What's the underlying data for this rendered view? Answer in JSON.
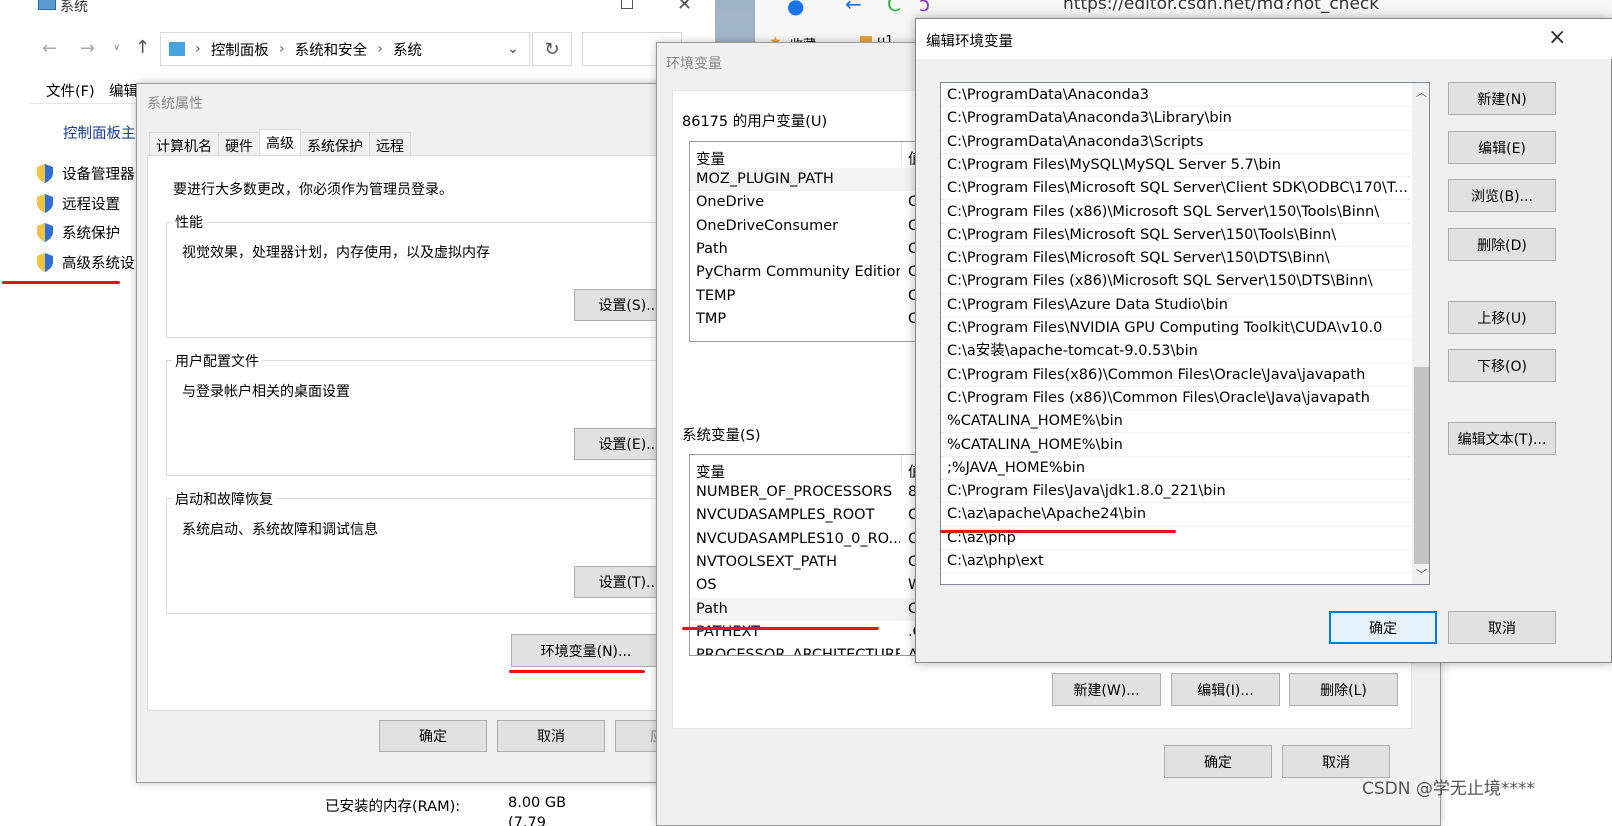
{
  "explorer": {
    "title": "系统",
    "breadcrumb": [
      "控制面板",
      "系统和安全",
      "系统"
    ],
    "menu": [
      "文件(F)",
      "编辑"
    ],
    "sidebar_home": "控制面板主",
    "sidebar_items": [
      "设备管理器",
      "远程设置",
      "系统保护",
      "高级系统设"
    ],
    "ram_label": "已安装的内存(RAM):",
    "ram_value": "8.00 GB",
    "ram_value2": "(7.79"
  },
  "browser": {
    "url": "https://editor.csdn.net/md?not_check",
    "bookmark": "收藏",
    "bookmark2": "u1"
  },
  "sysprops": {
    "title": "系统属性",
    "tabs": [
      "计算机名",
      "硬件",
      "高级",
      "系统保护",
      "远程"
    ],
    "admin_note": "要进行大多数更改，你必须作为管理员登录。",
    "groups": [
      {
        "label": "性能",
        "desc": "视觉效果，处理器计划，内存使用，以及虚拟内存",
        "button": "设置(S)..."
      },
      {
        "label": "用户配置文件",
        "desc": "与登录帐户相关的桌面设置",
        "button": "设置(E)..."
      },
      {
        "label": "启动和故障恢复",
        "desc": "系统启动、系统故障和调试信息",
        "button": "设置(T)..."
      }
    ],
    "env_button": "环境变量(N)...",
    "ok": "确定",
    "cancel": "取消",
    "apply": "应"
  },
  "envvars": {
    "title": "环境变量",
    "user_label": "86175 的用户变量(U)",
    "col_var": "变量",
    "col_val": "值",
    "user_vars": [
      {
        "name": "MOZ_PLUGIN_PATH",
        "val": ""
      },
      {
        "name": "OneDrive",
        "val": "C"
      },
      {
        "name": "OneDriveConsumer",
        "val": "C"
      },
      {
        "name": "Path",
        "val": "C"
      },
      {
        "name": "PyCharm Community Edition",
        "val": "C"
      },
      {
        "name": "TEMP",
        "val": "C"
      },
      {
        "name": "TMP",
        "val": "C"
      }
    ],
    "sys_label": "系统变量(S)",
    "sys_vars": [
      {
        "name": "NUMBER_OF_PROCESSORS",
        "val": "8"
      },
      {
        "name": "NVCUDASAMPLES_ROOT",
        "val": "C"
      },
      {
        "name": "NVCUDASAMPLES10_0_RO...",
        "val": "C"
      },
      {
        "name": "NVTOOLSEXT_PATH",
        "val": "C"
      },
      {
        "name": "OS",
        "val": "W"
      },
      {
        "name": "Path",
        "val": "C"
      },
      {
        "name": "PATHEXT",
        "val": ".C"
      },
      {
        "name": "PROCESSOR_ARCHITECTURE",
        "val": "A"
      }
    ],
    "new_btn": "新建(W)...",
    "edit_btn": "编辑(I)...",
    "delete_btn": "删除(L)",
    "ok": "确定",
    "cancel": "取消"
  },
  "editenv": {
    "title": "编辑环境变量",
    "close": "×",
    "paths": [
      "C:\\ProgramData\\Anaconda3",
      "C:\\ProgramData\\Anaconda3\\Library\\bin",
      "C:\\ProgramData\\Anaconda3\\Scripts",
      "C:\\Program Files\\MySQL\\MySQL Server 5.7\\bin",
      "C:\\Program Files\\Microsoft SQL Server\\Client SDK\\ODBC\\170\\T...",
      "C:\\Program Files (x86)\\Microsoft SQL Server\\150\\Tools\\Binn\\",
      "C:\\Program Files\\Microsoft SQL Server\\150\\Tools\\Binn\\",
      "C:\\Program Files\\Microsoft SQL Server\\150\\DTS\\Binn\\",
      "C:\\Program Files (x86)\\Microsoft SQL Server\\150\\DTS\\Binn\\",
      "C:\\Program Files\\Azure Data Studio\\bin",
      "C:\\Program Files\\NVIDIA GPU Computing Toolkit\\CUDA\\v10.0",
      "C:\\a安装\\apache-tomcat-9.0.53\\bin",
      "C:\\Program Files(x86)\\Common Files\\Oracle\\Java\\javapath",
      "C:\\Program Files (x86)\\Common Files\\Oracle\\Java\\javapath",
      "%CATALINA_HOME%\\bin",
      "%CATALINA_HOME%\\bin",
      ";%JAVA_HOME%bin",
      "C:\\Program Files\\Java\\jdk1.8.0_221\\bin",
      "C:\\az\\apache\\Apache24\\bin",
      "C:\\az\\php",
      "C:\\az\\php\\ext"
    ],
    "buttons": [
      "新建(N)",
      "编辑(E)",
      "浏览(B)...",
      "删除(D)",
      "上移(U)",
      "下移(O)",
      "编辑文本(T)..."
    ],
    "ok": "确定",
    "cancel": "取消"
  },
  "watermark": "CSDN @学无止境****"
}
